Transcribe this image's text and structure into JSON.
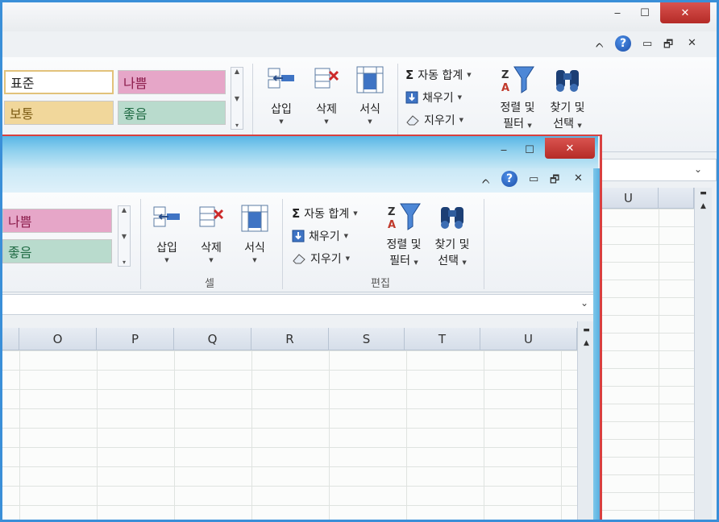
{
  "back_window": {
    "title_buttons": {
      "minimize": "‒",
      "maximize": "☐",
      "close": "✕"
    },
    "ribbon_controls": {
      "collapse": "ᨈ",
      "help": "?",
      "minimize": "▭",
      "restore": "🗗",
      "close": "✕"
    },
    "styles": {
      "normal": "표준",
      "bad": "나쁨",
      "neutral": "보통",
      "good": "좋음"
    },
    "cells_group": {
      "insert": "삽입",
      "delete": "삭제",
      "format": "서식"
    },
    "editing_group": {
      "autosum": "자동 합계",
      "fill": "채우기",
      "clear": "지우기",
      "sort_filter_line1": "정렬 및",
      "sort_filter_line2": "필터",
      "find_select_line1": "찾기 및",
      "find_select_line2": "선택"
    },
    "column_visible": "U"
  },
  "front_window": {
    "title_buttons": {
      "minimize": "‒",
      "maximize": "☐",
      "close": "✕"
    },
    "ribbon_controls": {
      "collapse": "ᨈ",
      "help": "?",
      "minimize": "▭",
      "restore": "🗗",
      "close": "✕"
    },
    "styles": {
      "bad": "나쁨",
      "good": "좋음"
    },
    "cells_group": {
      "insert": "삽입",
      "delete": "삭제",
      "format": "서식",
      "label": "셀"
    },
    "editing_group": {
      "autosum": "자동 합계",
      "fill": "채우기",
      "clear": "지우기",
      "sort_filter_line1": "정렬 및",
      "sort_filter_line2": "필터",
      "find_select_line1": "찾기 및",
      "find_select_line2": "선택",
      "label": "편집"
    },
    "columns": [
      "O",
      "P",
      "Q",
      "R",
      "S",
      "T",
      "U"
    ]
  },
  "icons": {
    "insert": "insert-cells-icon",
    "delete": "delete-cells-icon",
    "format": "format-cells-icon",
    "autosum": "sigma-icon",
    "fill": "fill-down-icon",
    "clear": "eraser-icon",
    "sort_filter": "funnel-icon",
    "find_select": "binoculars-icon"
  },
  "colors": {
    "close_red": "#c9302c",
    "accent_blue": "#3a8fd8",
    "highlight_border": "#d84040",
    "bad_fill": "#e6a6c8",
    "neutral_fill": "#f1d79b",
    "good_fill": "#b9dbcd"
  }
}
